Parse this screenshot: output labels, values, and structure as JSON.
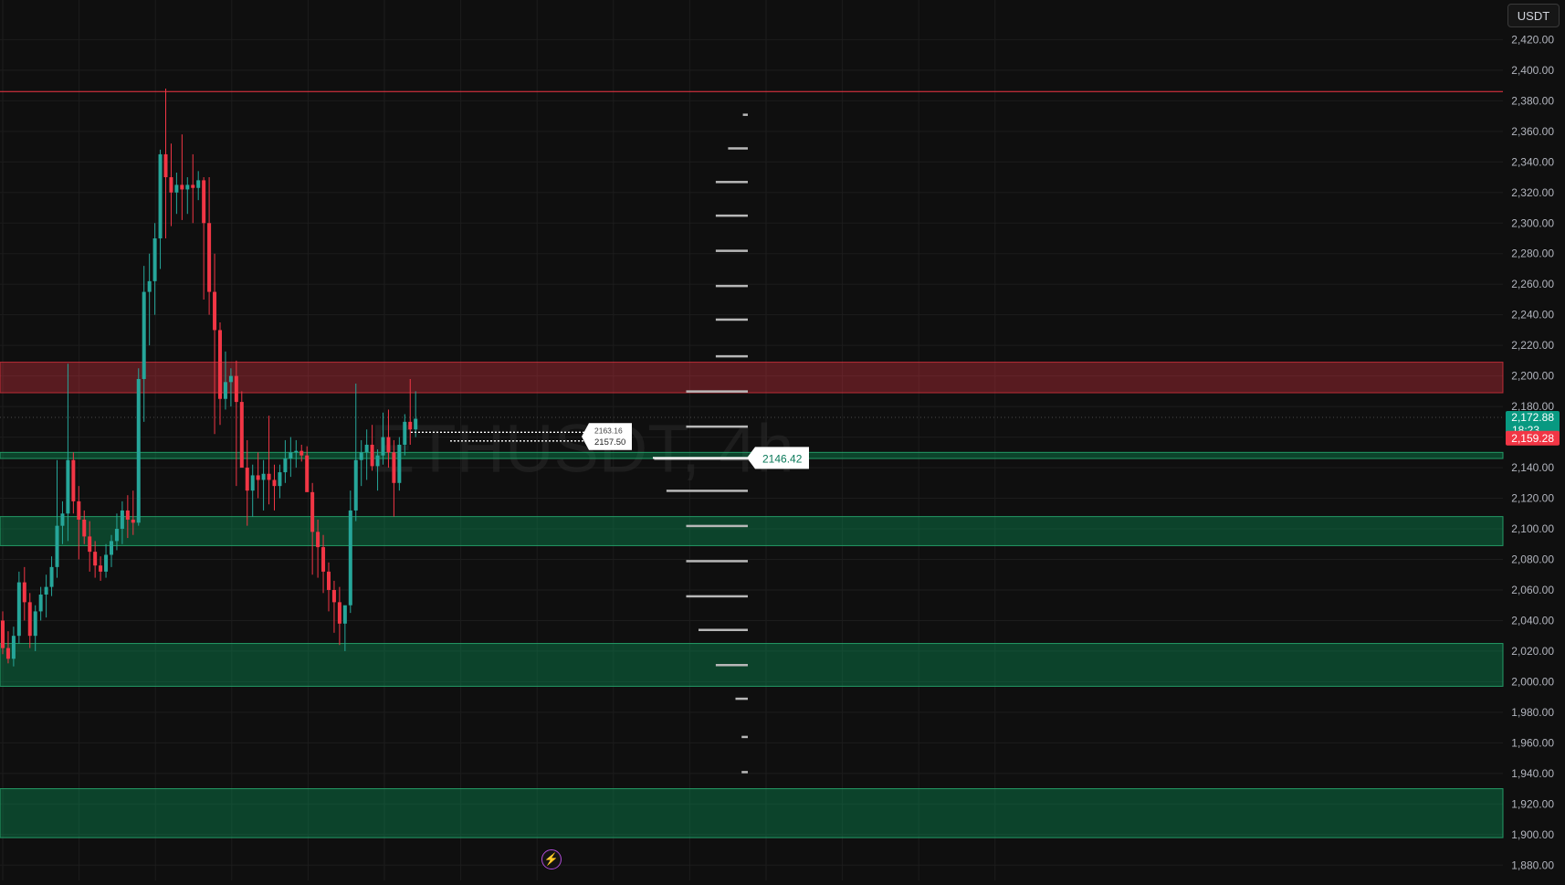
{
  "chart_data": {
    "type": "candlestick",
    "symbol_watermark": "ETHUSDT, 4h",
    "currency": "USDT",
    "ylim": [
      1870,
      2428
    ],
    "y_ticks": [
      "2,420.00",
      "2,400.00",
      "2,380.00",
      "2,360.00",
      "2,340.00",
      "2,320.00",
      "2,300.00",
      "2,280.00",
      "2,260.00",
      "2,240.00",
      "2,220.00",
      "2,200.00",
      "2,180.00",
      "2,160.00",
      "2,140.00",
      "2,120.00",
      "2,100.00",
      "2,080.00",
      "2,060.00",
      "2,040.00",
      "2,020.00",
      "2,000.00",
      "1,980.00",
      "1,960.00",
      "1,940.00",
      "1,920.00",
      "1,900.00",
      "1,880.00"
    ],
    "y_tick_values": [
      2420,
      2400,
      2380,
      2360,
      2340,
      2320,
      2300,
      2280,
      2260,
      2240,
      2220,
      2200,
      2180,
      2160,
      2140,
      2120,
      2100,
      2080,
      2060,
      2040,
      2020,
      2000,
      1980,
      1960,
      1940,
      1920,
      1900,
      1880
    ],
    "grid": true,
    "candles": [
      [
        2040,
        2046,
        2018,
        2022
      ],
      [
        2022,
        2033,
        2012,
        2015
      ],
      [
        2015,
        2036,
        2010,
        2030
      ],
      [
        2030,
        2072,
        2025,
        2065
      ],
      [
        2065,
        2075,
        2040,
        2052
      ],
      [
        2052,
        2058,
        2022,
        2030
      ],
      [
        2030,
        2050,
        2020,
        2046
      ],
      [
        2046,
        2062,
        2040,
        2057
      ],
      [
        2057,
        2070,
        2042,
        2062
      ],
      [
        2062,
        2082,
        2056,
        2075
      ],
      [
        2075,
        2145,
        2068,
        2102
      ],
      [
        2102,
        2118,
        2090,
        2110
      ],
      [
        2110,
        2208,
        2092,
        2145
      ],
      [
        2145,
        2150,
        2110,
        2118
      ],
      [
        2118,
        2128,
        2080,
        2106
      ],
      [
        2106,
        2112,
        2090,
        2095
      ],
      [
        2095,
        2105,
        2072,
        2085
      ],
      [
        2085,
        2092,
        2068,
        2076
      ],
      [
        2076,
        2082,
        2066,
        2072
      ],
      [
        2072,
        2090,
        2068,
        2083
      ],
      [
        2083,
        2096,
        2075,
        2092
      ],
      [
        2092,
        2110,
        2086,
        2100
      ],
      [
        2100,
        2118,
        2090,
        2112
      ],
      [
        2112,
        2122,
        2094,
        2106
      ],
      [
        2106,
        2125,
        2096,
        2104
      ],
      [
        2104,
        2205,
        2102,
        2198
      ],
      [
        2198,
        2272,
        2170,
        2255
      ],
      [
        2255,
        2280,
        2220,
        2262
      ],
      [
        2262,
        2300,
        2240,
        2290
      ],
      [
        2290,
        2348,
        2270,
        2345
      ],
      [
        2345,
        2388,
        2290,
        2330
      ],
      [
        2330,
        2352,
        2298,
        2320
      ],
      [
        2320,
        2333,
        2306,
        2325
      ],
      [
        2325,
        2358,
        2302,
        2322
      ],
      [
        2322,
        2330,
        2306,
        2325
      ],
      [
        2325,
        2345,
        2300,
        2323
      ],
      [
        2323,
        2334,
        2315,
        2328
      ],
      [
        2328,
        2330,
        2250,
        2300
      ],
      [
        2300,
        2330,
        2240,
        2255
      ],
      [
        2255,
        2280,
        2162,
        2230
      ],
      [
        2230,
        2235,
        2168,
        2185
      ],
      [
        2185,
        2216,
        2178,
        2196
      ],
      [
        2196,
        2205,
        2180,
        2200
      ],
      [
        2200,
        2210,
        2128,
        2183
      ],
      [
        2183,
        2190,
        2152,
        2140
      ],
      [
        2140,
        2158,
        2102,
        2125
      ],
      [
        2125,
        2142,
        2108,
        2135
      ],
      [
        2135,
        2150,
        2120,
        2132
      ],
      [
        2132,
        2145,
        2112,
        2136
      ],
      [
        2136,
        2174,
        2116,
        2132
      ],
      [
        2132,
        2142,
        2112,
        2128
      ],
      [
        2128,
        2142,
        2120,
        2137
      ],
      [
        2137,
        2158,
        2130,
        2146
      ],
      [
        2146,
        2160,
        2134,
        2150
      ],
      [
        2150,
        2158,
        2140,
        2151
      ],
      [
        2151,
        2155,
        2144,
        2148
      ],
      [
        2148,
        2154,
        2130,
        2124
      ],
      [
        2124,
        2130,
        2070,
        2098
      ],
      [
        2098,
        2106,
        2068,
        2088
      ],
      [
        2088,
        2096,
        2058,
        2072
      ],
      [
        2072,
        2078,
        2046,
        2060
      ],
      [
        2060,
        2066,
        2032,
        2052
      ],
      [
        2052,
        2062,
        2024,
        2038
      ],
      [
        2038,
        2044,
        2020,
        2050
      ],
      [
        2050,
        2125,
        2045,
        2112
      ],
      [
        2112,
        2195,
        2105,
        2145
      ],
      [
        2145,
        2158,
        2128,
        2150
      ],
      [
        2150,
        2165,
        2132,
        2155
      ],
      [
        2155,
        2168,
        2138,
        2141
      ],
      [
        2141,
        2152,
        2125,
        2148
      ],
      [
        2148,
        2176,
        2142,
        2160
      ],
      [
        2160,
        2178,
        2140,
        2150
      ],
      [
        2150,
        2158,
        2108,
        2130
      ],
      [
        2130,
        2160,
        2125,
        2155
      ],
      [
        2155,
        2175,
        2148,
        2170
      ],
      [
        2170,
        2198,
        2155,
        2165
      ],
      [
        2165,
        2190,
        2160,
        2172
      ]
    ],
    "bull_color": "#26a69a",
    "bear_color": "#f23645",
    "resistance_line": 2386,
    "zones": [
      {
        "kind": "supply",
        "low": 2189,
        "high": 2209
      },
      {
        "kind": "demand",
        "low": 2146,
        "high": 2150
      },
      {
        "kind": "demand",
        "low": 2089,
        "high": 2108
      },
      {
        "kind": "demand",
        "low": 1997,
        "high": 2025
      },
      {
        "kind": "demand",
        "low": 1898,
        "high": 1930
      }
    ],
    "histogram": [
      [
        2371,
        4
      ],
      [
        2349,
        16
      ],
      [
        2327,
        26
      ],
      [
        2305,
        26
      ],
      [
        2282,
        26
      ],
      [
        2259,
        26
      ],
      [
        2237,
        26
      ],
      [
        2213,
        26
      ],
      [
        2190,
        50
      ],
      [
        2167,
        50
      ],
      [
        2146,
        76
      ],
      [
        2125,
        66
      ],
      [
        2102,
        50
      ],
      [
        2079,
        50
      ],
      [
        2056,
        50
      ],
      [
        2034,
        40
      ],
      [
        2011,
        26
      ],
      [
        1989,
        10
      ],
      [
        1964,
        5
      ],
      [
        1941,
        5
      ]
    ],
    "poc_label": "2146.42",
    "poc_value": 2146.42,
    "order_lines": [
      {
        "label": "2163.16",
        "value": 2163.16
      },
      {
        "label": "2157.50",
        "value": 2157.5
      }
    ],
    "last_price": {
      "label": "2,172.88",
      "value": 2172.88,
      "countdown": "18:23",
      "color": "#089981"
    },
    "bid_price": {
      "label": "2,159.28",
      "value": 2159.28,
      "color": "#f23645"
    }
  },
  "toolbar": {
    "currency_button": "USDT"
  }
}
